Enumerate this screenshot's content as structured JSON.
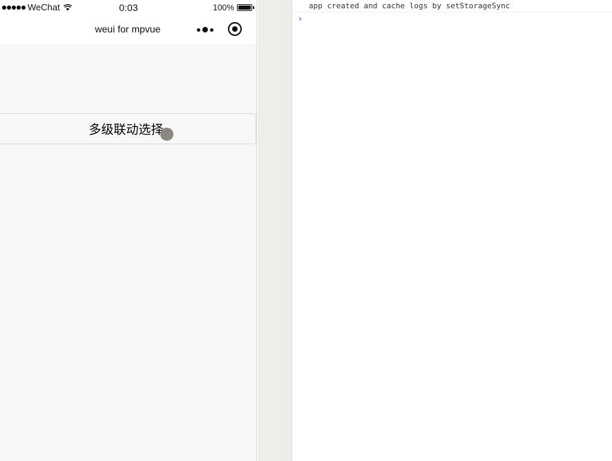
{
  "status_bar": {
    "carrier": "WeChat",
    "time": "0:03",
    "battery": "100%",
    "battery_level": 1.0
  },
  "nav_bar": {
    "title": "weui for mpvue"
  },
  "page": {
    "cascade_button_label": "多级联动选择"
  },
  "console": {
    "log_lines": [
      "app created and cache logs by setStorageSync"
    ],
    "prompt_symbol": "›",
    "prompt_value": ""
  },
  "icons": {
    "signal": "signal-dots-icon",
    "wifi": "wifi-icon",
    "battery": "battery-icon",
    "more": "more-dots-icon",
    "close": "record-close-icon",
    "touch": "touch-indicator-icon",
    "prompt": "chevron-right-icon"
  },
  "colors": {
    "page_background": "#f7f7f7",
    "prompt_accent": "#2a6ad6",
    "touch_indicator": "#8d8782"
  }
}
